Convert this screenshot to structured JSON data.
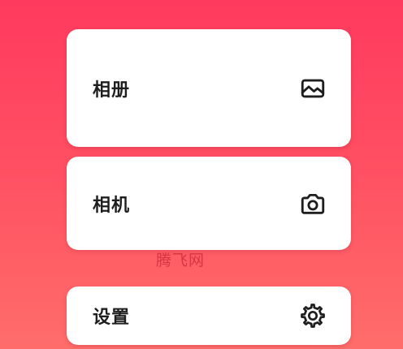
{
  "colors": {
    "background_top": "#ff3a5e",
    "background_bottom": "#ff6d6a",
    "card": "#ffffff",
    "text": "#1e1e1e",
    "watermark": "#d0303e"
  },
  "menu": {
    "items": [
      {
        "label": "相册",
        "icon": "image-icon"
      },
      {
        "label": "相机",
        "icon": "camera-icon"
      },
      {
        "label": "设置",
        "icon": "gear-icon"
      }
    ]
  },
  "watermark": {
    "text": "腾飞网"
  }
}
